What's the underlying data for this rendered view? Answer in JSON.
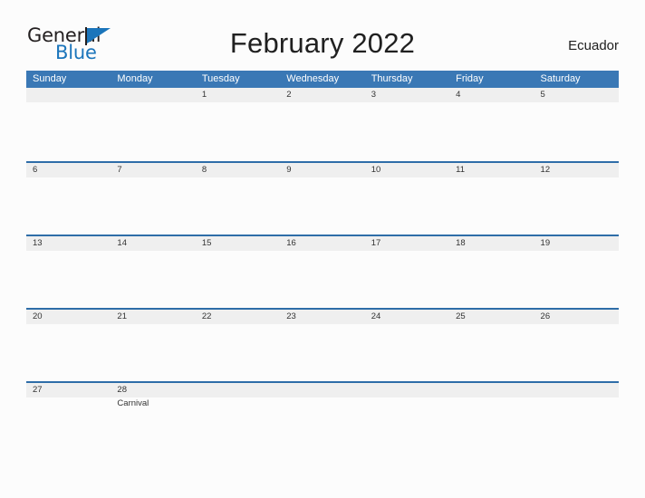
{
  "brand": {
    "name_part1": "General",
    "name_part2": "Blue",
    "flag_icon": "blue-triangle-flag-icon",
    "accent_color": "#1b75bb"
  },
  "header": {
    "title": "February 2022",
    "region": "Ecuador"
  },
  "calendar": {
    "header_bg_color": "#3a78b5",
    "band_bg_color": "#efefef",
    "row_border_color": "#2e6da8",
    "weekdays": [
      "Sunday",
      "Monday",
      "Tuesday",
      "Wednesday",
      "Thursday",
      "Friday",
      "Saturday"
    ],
    "weeks": [
      {
        "days": [
          {
            "num": "",
            "events": []
          },
          {
            "num": "",
            "events": []
          },
          {
            "num": "1",
            "events": []
          },
          {
            "num": "2",
            "events": []
          },
          {
            "num": "3",
            "events": []
          },
          {
            "num": "4",
            "events": []
          },
          {
            "num": "5",
            "events": []
          }
        ]
      },
      {
        "days": [
          {
            "num": "6",
            "events": []
          },
          {
            "num": "7",
            "events": []
          },
          {
            "num": "8",
            "events": []
          },
          {
            "num": "9",
            "events": []
          },
          {
            "num": "10",
            "events": []
          },
          {
            "num": "11",
            "events": []
          },
          {
            "num": "12",
            "events": []
          }
        ]
      },
      {
        "days": [
          {
            "num": "13",
            "events": []
          },
          {
            "num": "14",
            "events": []
          },
          {
            "num": "15",
            "events": []
          },
          {
            "num": "16",
            "events": []
          },
          {
            "num": "17",
            "events": []
          },
          {
            "num": "18",
            "events": []
          },
          {
            "num": "19",
            "events": []
          }
        ]
      },
      {
        "days": [
          {
            "num": "20",
            "events": []
          },
          {
            "num": "21",
            "events": []
          },
          {
            "num": "22",
            "events": []
          },
          {
            "num": "23",
            "events": []
          },
          {
            "num": "24",
            "events": []
          },
          {
            "num": "25",
            "events": []
          },
          {
            "num": "26",
            "events": []
          }
        ]
      },
      {
        "days": [
          {
            "num": "27",
            "events": []
          },
          {
            "num": "28",
            "events": [
              "Carnival"
            ]
          },
          {
            "num": "",
            "events": []
          },
          {
            "num": "",
            "events": []
          },
          {
            "num": "",
            "events": []
          },
          {
            "num": "",
            "events": []
          },
          {
            "num": "",
            "events": []
          }
        ]
      }
    ]
  }
}
